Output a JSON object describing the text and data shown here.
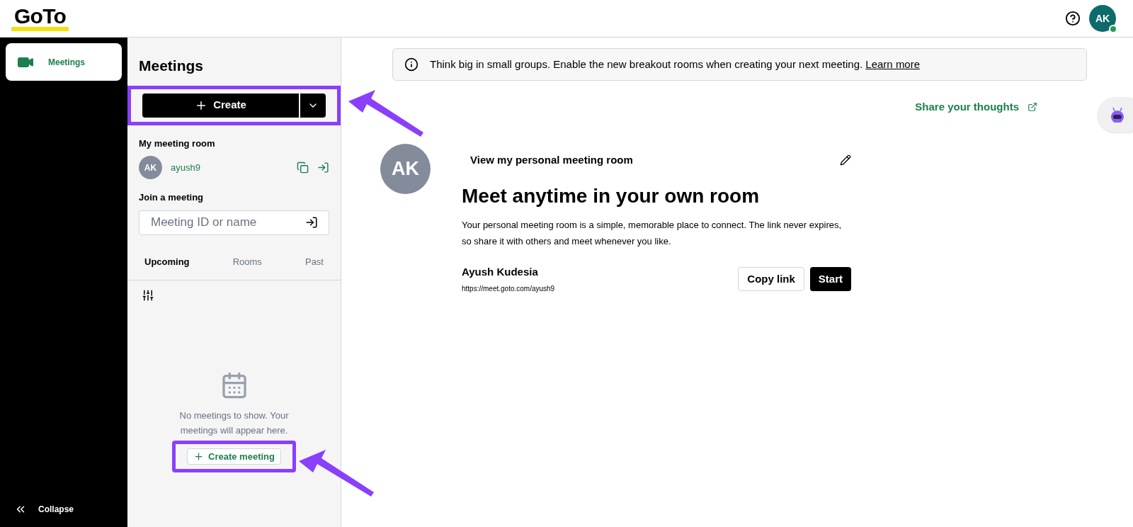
{
  "header": {
    "logo": "GoTo",
    "avatar": {
      "initials": "AK",
      "online": true
    }
  },
  "nav": {
    "items": [
      {
        "label": "Meetings",
        "selected": true
      }
    ],
    "collapse": "Collapse"
  },
  "panel": {
    "title": "Meetings",
    "create": {
      "label": "Create",
      "highlighted": true
    },
    "my_room": {
      "heading": "My meeting room",
      "initials": "AK",
      "name": "ayush9"
    },
    "join": {
      "heading": "Join a meeting",
      "placeholder": "Meeting ID or name"
    },
    "tabs": [
      {
        "label": "Upcoming",
        "selected": true
      },
      {
        "label": "Rooms",
        "selected": false
      },
      {
        "label": "Past",
        "selected": false
      }
    ],
    "empty": {
      "message": "No meetings to show. Your meetings will appear here.",
      "button": {
        "label": "Create meeting",
        "highlighted": true
      }
    }
  },
  "main": {
    "banner": {
      "text": "Think big in small groups. Enable the new breakout rooms when creating your next meeting.",
      "link": "Learn more"
    },
    "feedback": "Share your thoughts",
    "room": {
      "initials": "AK",
      "link_title": "View my personal meeting room",
      "title": "Meet anytime in your own room",
      "description": "Your personal meeting room is a simple, memorable place to connect. The link never expires, so share it with others and meet whenever you like.",
      "owner": "Ayush Kudesia",
      "url": "https://meet.goto.com/ayush9",
      "buttons": [
        {
          "label": "Copy link",
          "kind": "secondary"
        },
        {
          "label": "Start",
          "kind": "primary"
        }
      ]
    }
  }
}
